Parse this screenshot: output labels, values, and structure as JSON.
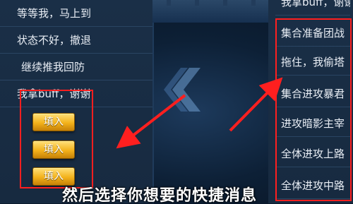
{
  "left_list": {
    "items": [
      {
        "label": "等等我，马上到"
      },
      {
        "label": "状态不好，撤退"
      },
      {
        "label": "继续推我回防"
      },
      {
        "label": "我拿buff，谢谢"
      }
    ],
    "fill_buttons": [
      {
        "label": "填入"
      },
      {
        "label": "填入"
      },
      {
        "label": "填入"
      }
    ]
  },
  "right_list": {
    "items": [
      {
        "label": "我拿buff，谢谢"
      },
      {
        "label": "集合准备团战"
      },
      {
        "label": "拖住，我偷塔"
      },
      {
        "label": "集合进攻暴君"
      },
      {
        "label": "进攻暗影主宰"
      },
      {
        "label": "全体进攻上路"
      },
      {
        "label": "全体进攻中路"
      }
    ]
  },
  "caption": "然后选择你想要的快捷消息",
  "colors": {
    "annotation": "#ff1f1f",
    "button_gold": "#f3b21b",
    "panel": "#172a40"
  }
}
